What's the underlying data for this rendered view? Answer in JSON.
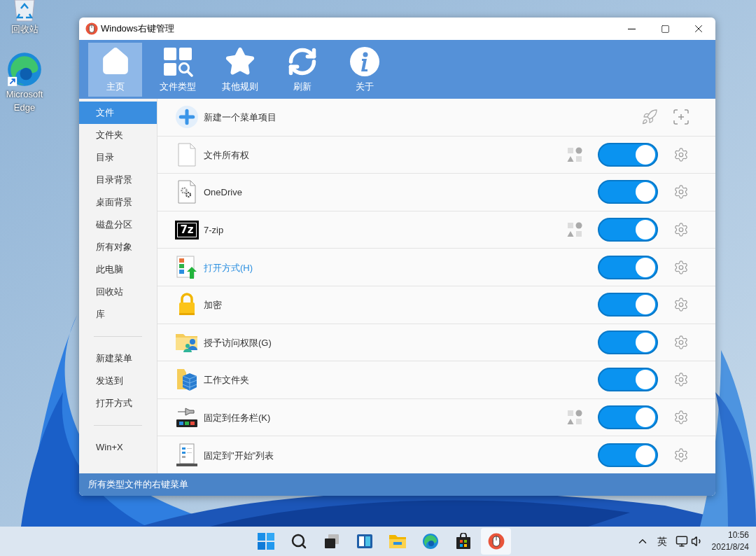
{
  "desktop": {
    "icons": [
      {
        "kind": "recycle-bin",
        "label": "回收站"
      },
      {
        "kind": "edge",
        "label": "Microsoft Edge"
      }
    ]
  },
  "window": {
    "title": "Windows右键管理"
  },
  "toolbar": [
    {
      "kind": "home",
      "label": "主页",
      "selected": true
    },
    {
      "kind": "file-types",
      "label": "文件类型",
      "selected": false
    },
    {
      "kind": "star",
      "label": "其他规则",
      "selected": false
    },
    {
      "kind": "refresh",
      "label": "刷新",
      "selected": false
    },
    {
      "kind": "info",
      "label": "关于",
      "selected": false
    }
  ],
  "sidebar": {
    "groups": [
      {
        "items": [
          {
            "label": "文件",
            "selected": true
          },
          {
            "label": "文件夹",
            "selected": false
          },
          {
            "label": "目录",
            "selected": false
          },
          {
            "label": "目录背景",
            "selected": false
          },
          {
            "label": "桌面背景",
            "selected": false
          },
          {
            "label": "磁盘分区",
            "selected": false
          },
          {
            "label": "所有对象",
            "selected": false
          },
          {
            "label": "此电脑",
            "selected": false
          },
          {
            "label": "回收站",
            "selected": false
          },
          {
            "label": "库",
            "selected": false
          }
        ]
      },
      {
        "items": [
          {
            "label": "新建菜单",
            "selected": false
          },
          {
            "label": "发送到",
            "selected": false
          },
          {
            "label": "打开方式",
            "selected": false
          }
        ]
      },
      {
        "items": [
          {
            "label": "Win+X",
            "selected": false
          }
        ]
      }
    ]
  },
  "rows": [
    {
      "kind": "new",
      "label": "新建一个菜单项目"
    },
    {
      "kind": "item",
      "label": "文件所有权",
      "type_icon": true,
      "on": true,
      "highlighted": false
    },
    {
      "kind": "item",
      "label": "OneDrive",
      "type_icon": false,
      "on": true,
      "highlighted": false
    },
    {
      "kind": "item",
      "logo_text": "7z",
      "label": "7-zip",
      "type_icon": true,
      "on": true,
      "highlighted": false
    },
    {
      "kind": "item",
      "label": "打开方式(H)",
      "type_icon": false,
      "on": true,
      "highlighted": true
    },
    {
      "kind": "item",
      "label": "加密",
      "type_icon": false,
      "on": true,
      "highlighted": false
    },
    {
      "kind": "item",
      "label": "授予访问权限(G)",
      "type_icon": false,
      "on": true,
      "highlighted": false
    },
    {
      "kind": "item",
      "label": "工作文件夹",
      "type_icon": false,
      "on": true,
      "highlighted": false
    },
    {
      "kind": "item",
      "label": "固定到任务栏(K)",
      "type_icon": true,
      "on": true,
      "highlighted": false
    },
    {
      "kind": "item",
      "label": "固定到\"开始\"列表",
      "type_icon": false,
      "on": true,
      "highlighted": false
    }
  ],
  "status_bar": "所有类型文件的右键菜单",
  "taskbar": {
    "apps": [
      {
        "kind": "start",
        "selected": false
      },
      {
        "kind": "search",
        "selected": false
      },
      {
        "kind": "task-view",
        "selected": false
      },
      {
        "kind": "widgets",
        "selected": false
      },
      {
        "kind": "explorer",
        "selected": false
      },
      {
        "kind": "edge",
        "selected": false
      },
      {
        "kind": "store",
        "selected": false
      },
      {
        "kind": "mouse-app",
        "selected": true
      }
    ],
    "input_method": "英",
    "time": "10:56",
    "date": "2021/8/24"
  }
}
